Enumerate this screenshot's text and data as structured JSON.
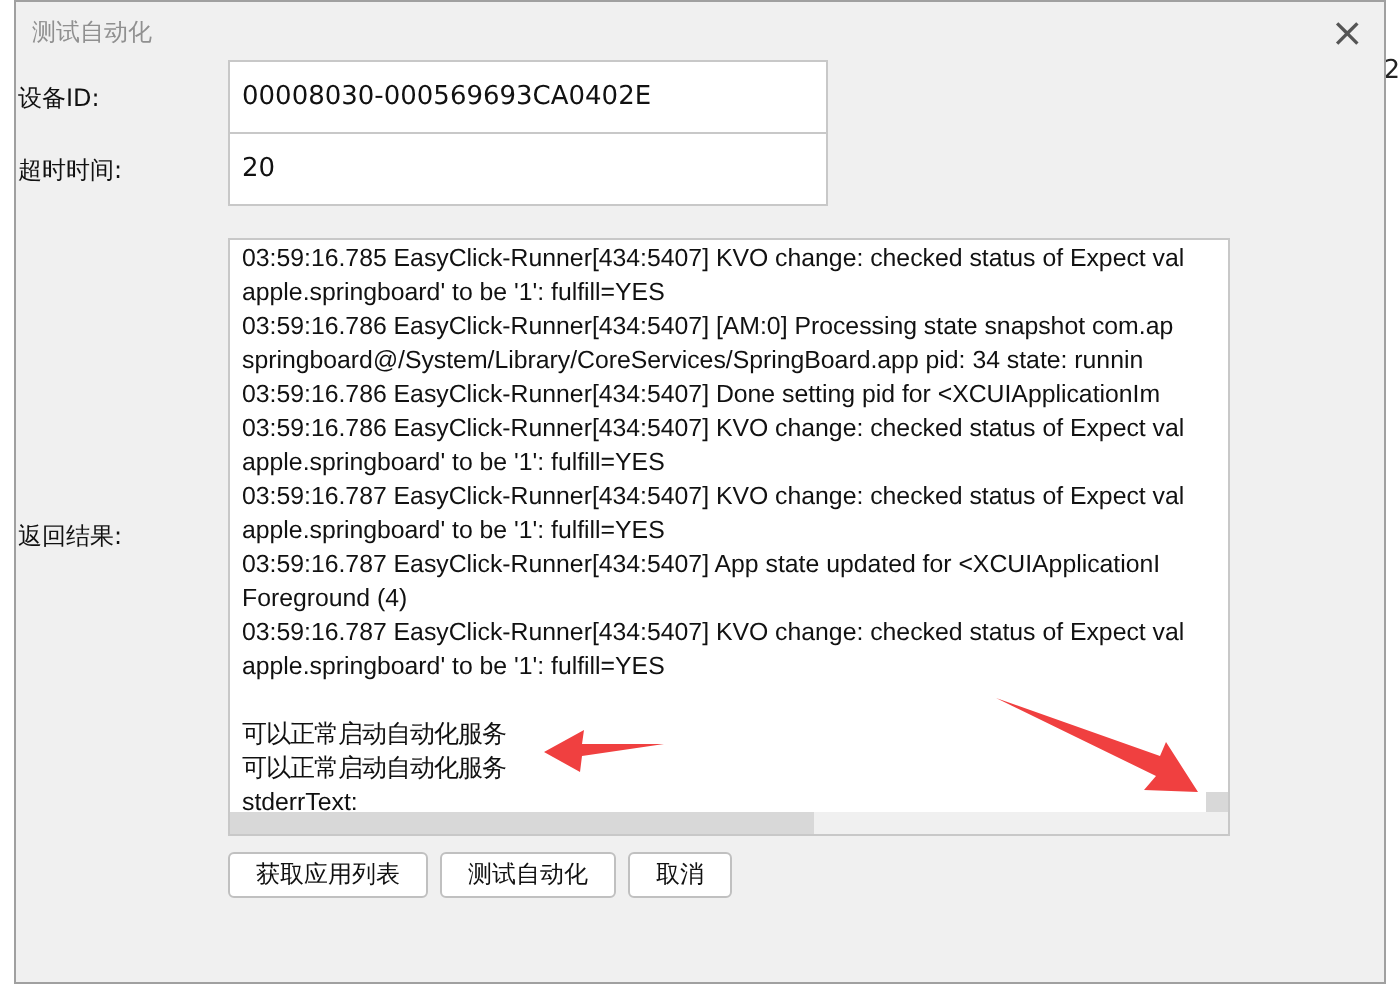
{
  "background": {
    "edge_text": "2"
  },
  "dialog": {
    "title": "测试自动化",
    "close": "×"
  },
  "fields": [
    {
      "label": "设备ID:",
      "value": "00008030-000569693CA0402E"
    },
    {
      "label": "超时时间:",
      "value": "20"
    }
  ],
  "result": {
    "label": "返回结果:",
    "blocks": [
      [
        "03:59:16.785 EasyClick-Runner[434:5407] KVO change: checked status of Expect val",
        "apple.springboard' to be '1': fulfill=YES",
        "03:59:16.786 EasyClick-Runner[434:5407] [AM:0] Processing state snapshot com.ap",
        "springboard@/System/Library/CoreServices/SpringBoard.app pid: 34 state: runnin",
        "03:59:16.786 EasyClick-Runner[434:5407] Done setting pid for <XCUIApplicationIm",
        "03:59:16.786 EasyClick-Runner[434:5407] KVO change: checked status of Expect val",
        "apple.springboard' to be '1': fulfill=YES",
        "03:59:16.787 EasyClick-Runner[434:5407] KVO change: checked status of Expect val",
        "apple.springboard' to be '1': fulfill=YES",
        "03:59:16.787 EasyClick-Runner[434:5407] App state updated for <XCUIApplicationI",
        "Foreground (4)",
        "03:59:16.787 EasyClick-Runner[434:5407] KVO change: checked status of Expect val",
        "apple.springboard' to be '1': fulfill=YES"
      ],
      [
        "可以正常启动自动化服务",
        "可以正常启动自动化服务",
        "stderrText:"
      ]
    ]
  },
  "buttons": [
    "获取应用列表",
    "测试自动化",
    "取消"
  ]
}
